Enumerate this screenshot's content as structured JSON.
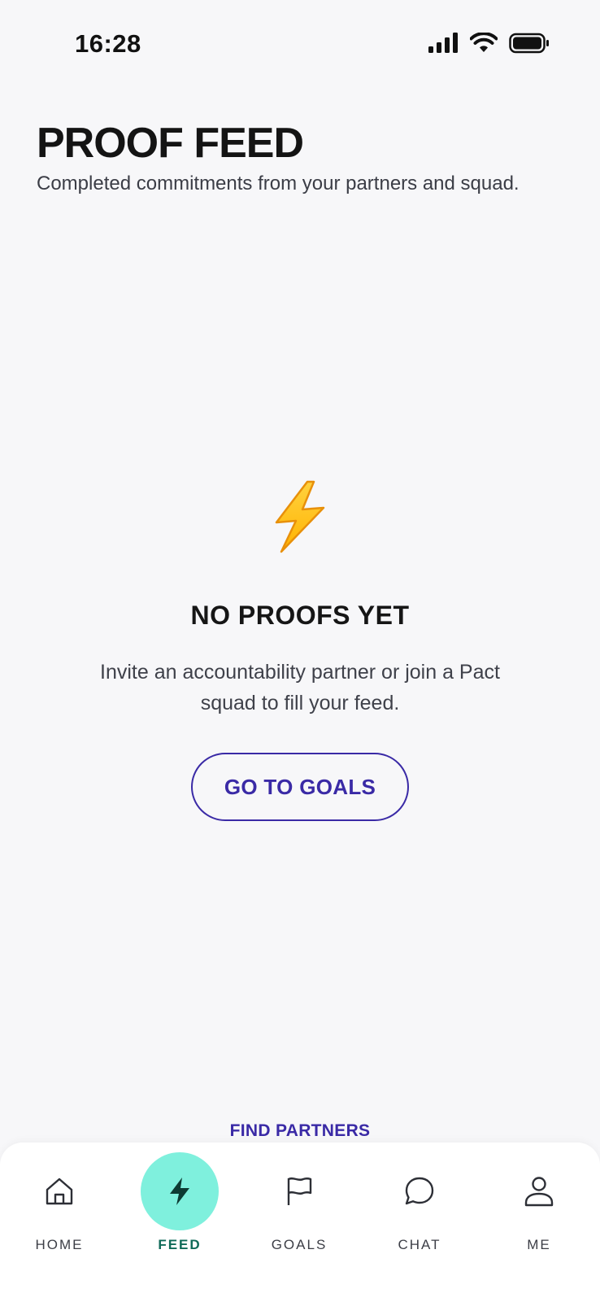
{
  "status_bar": {
    "time": "16:28"
  },
  "header": {
    "title": "PROOF FEED",
    "subtitle": "Completed commitments from your partners and squad."
  },
  "empty_state": {
    "icon": "lightning-bolt-emoji",
    "title": "NO PROOFS YET",
    "message": "Invite an accountability partner or join a Pact squad to fill your feed.",
    "button_label": "GO TO GOALS"
  },
  "find_partners_label": "FIND PARTNERS",
  "tabs": [
    {
      "label": "HOME",
      "icon": "home-icon"
    },
    {
      "label": "FEED",
      "icon": "bolt-icon",
      "active": true
    },
    {
      "label": "GOALS",
      "icon": "flag-icon"
    },
    {
      "label": "CHAT",
      "icon": "chat-bubble-icon"
    },
    {
      "label": "ME",
      "icon": "user-icon"
    }
  ],
  "colors": {
    "accent": "#3a2aa6",
    "active_tab_bg": "#7ff0dd",
    "active_tab_text": "#0f6a58",
    "background": "#f7f7f9"
  }
}
